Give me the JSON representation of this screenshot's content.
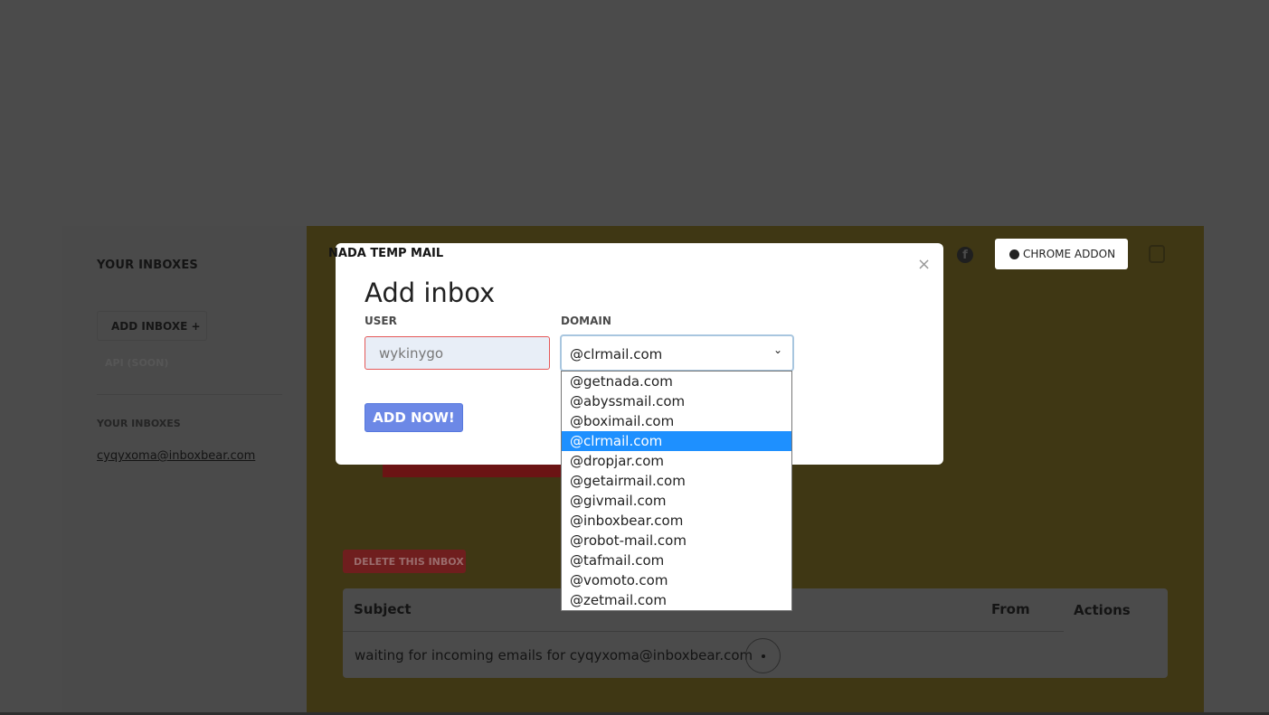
{
  "brand": "NADA TEMP MAIL",
  "sidebar": {
    "title": "YOUR INBOXES",
    "add_inbox": "ADD INBOXE +",
    "api": "API (SOON)",
    "inboxes_heading": "YOUR INBOXES",
    "inbox_email": "cyqyxoma@inboxbear.com"
  },
  "header": {
    "chrome_addon": "CHROME ADDON"
  },
  "main": {
    "delete_button": "DELETE THIS INBOX",
    "table": {
      "col_subject": "Subject",
      "col_from": "From",
      "col_actions": "Actions",
      "waiting_text": "waiting for incoming emails for cyqyxoma@inboxbear.com"
    }
  },
  "modal": {
    "title": "Add inbox",
    "close": "×",
    "user_label": "USER",
    "user_value": "wykinygo",
    "domain_label": "DOMAIN",
    "domain_selected": "@clrmail.com",
    "submit": "ADD NOW!",
    "domain_options": [
      "@getnada.com",
      "@abyssmail.com",
      "@boximail.com",
      "@clrmail.com",
      "@dropjar.com",
      "@getairmail.com",
      "@givmail.com",
      "@inboxbear.com",
      "@robot-mail.com",
      "@tafmail.com",
      "@vomoto.com",
      "@zetmail.com"
    ]
  },
  "colors": {
    "overlay": "#4b4b4b",
    "main_bg_dimmed": "#3f3714",
    "button_primary": "#6c88e6",
    "selected_option": "#1e90ff",
    "input_error_border": "#e45858"
  },
  "icons": [
    "facebook-icon",
    "download-icon",
    "theme-toggle-icon",
    "chevron-down-icon",
    "close-icon",
    "plus-icon"
  ]
}
